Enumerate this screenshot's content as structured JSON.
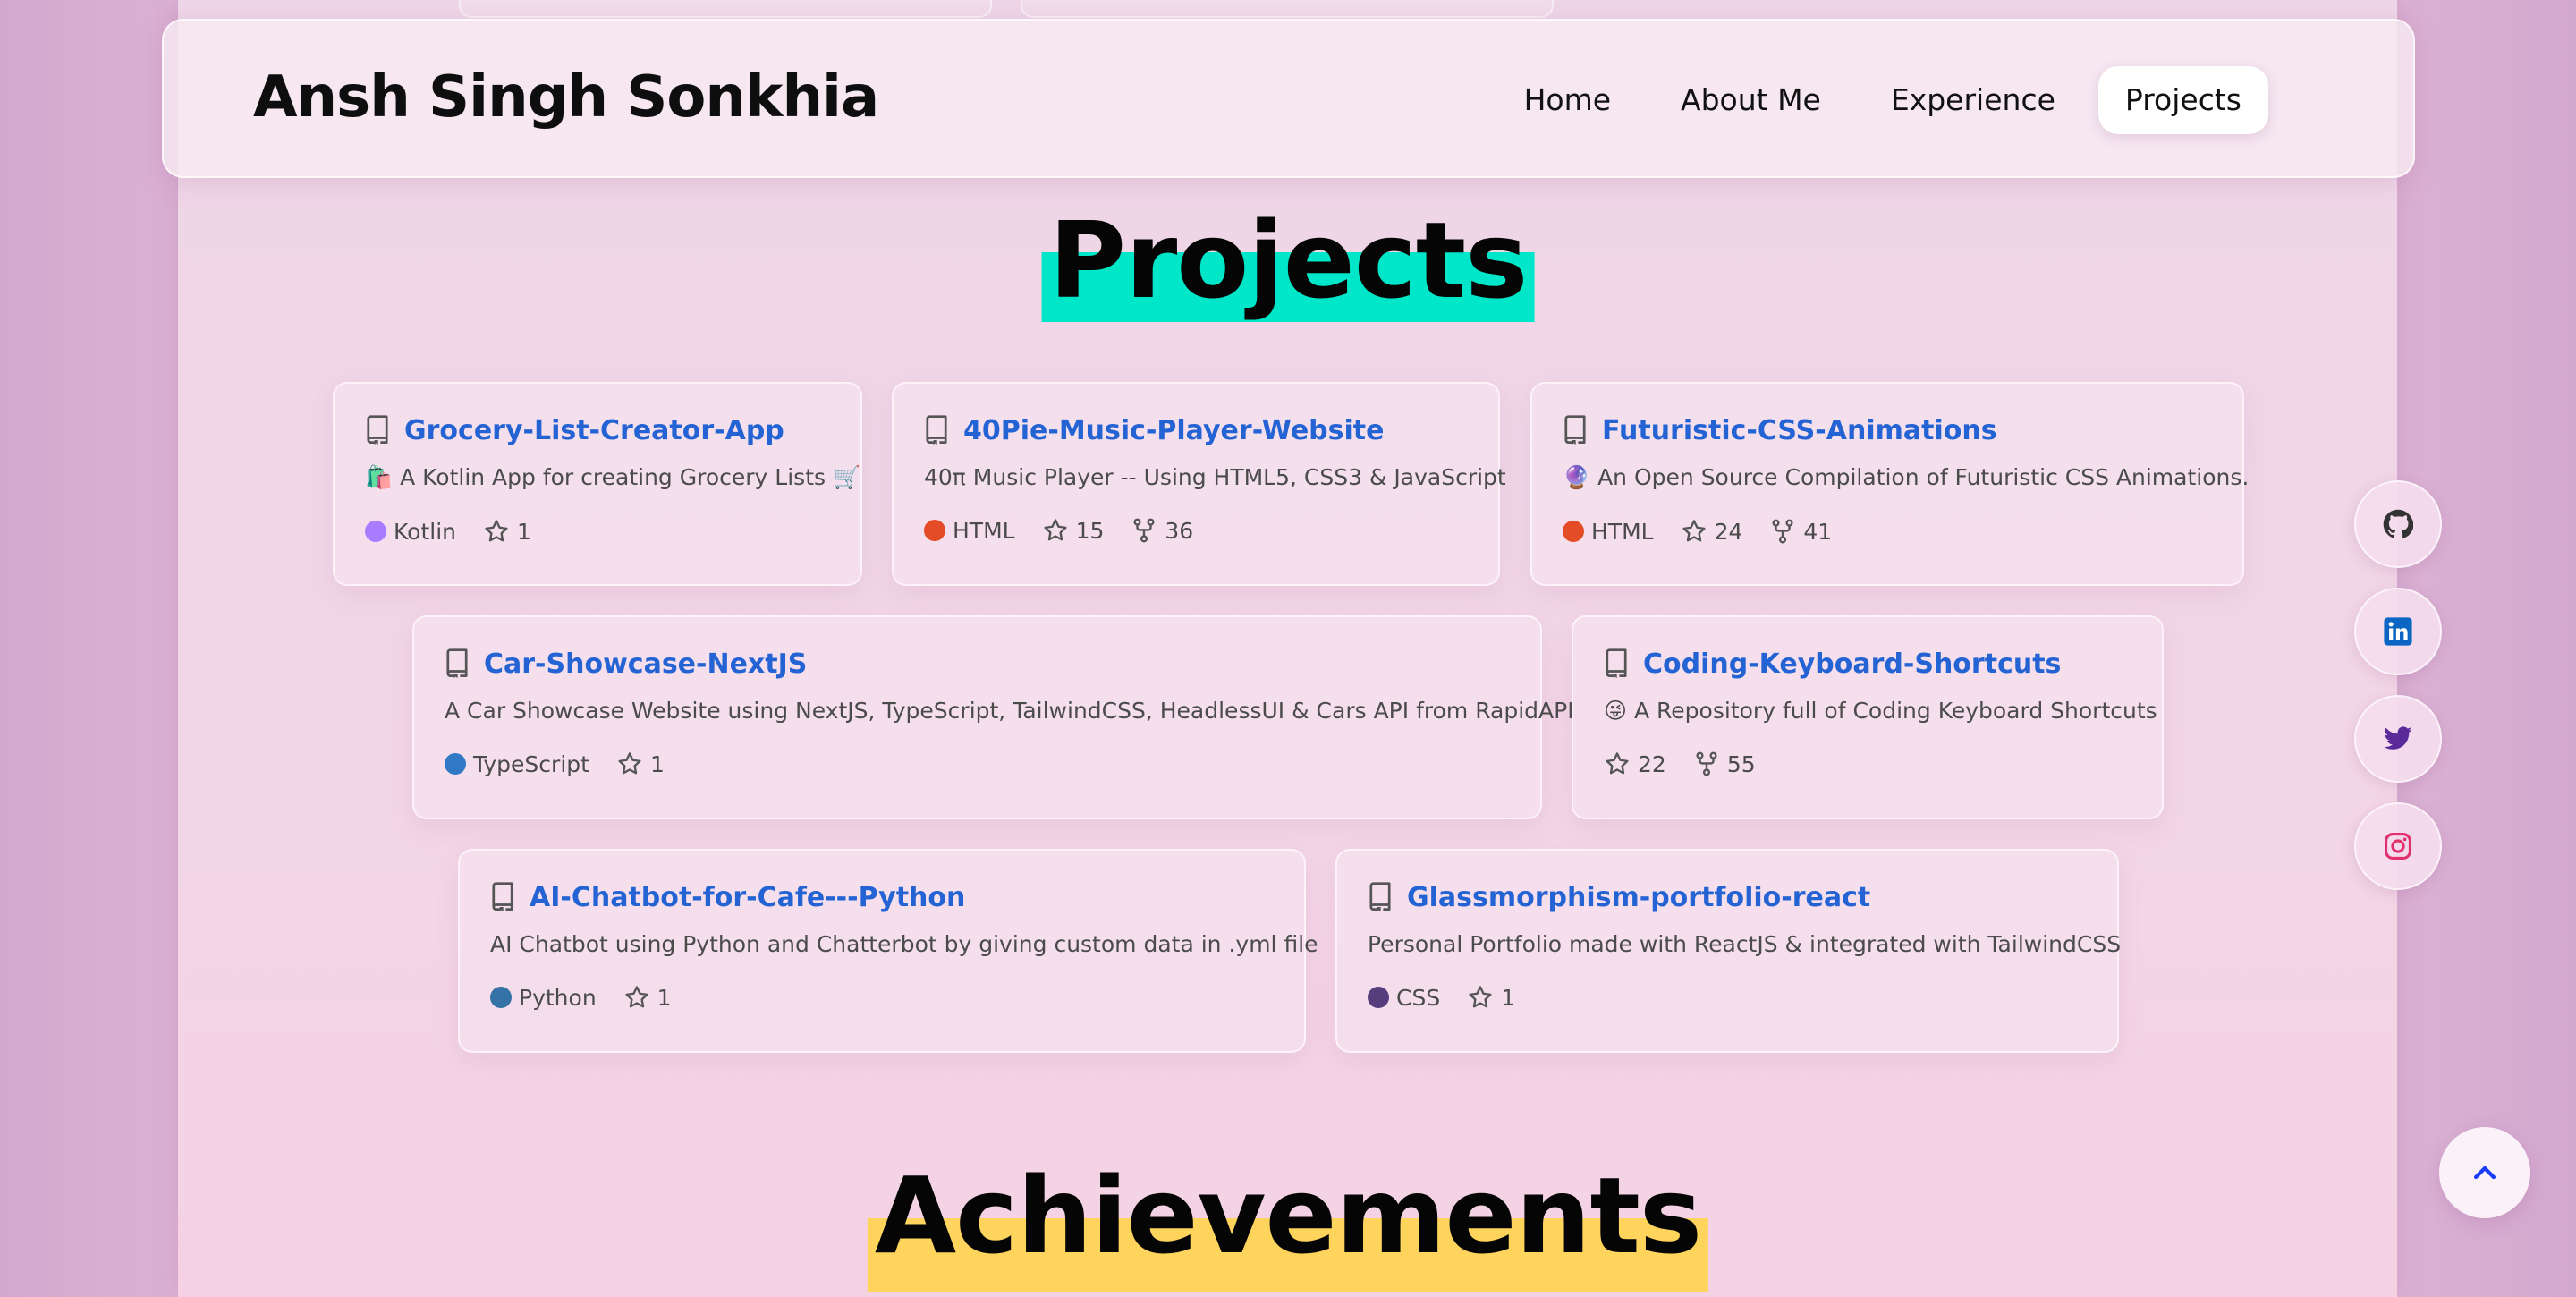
{
  "navbar": {
    "brand": "Ansh Singh Sonkhia",
    "links": [
      "Home",
      "About Me",
      "Experience",
      "Projects"
    ],
    "active": "Projects"
  },
  "projects_section": {
    "title": "Projects",
    "highlight_color": "#00e6c8",
    "cards": [
      {
        "name": "Grocery-List-Creator-App",
        "desc": "🛍️ A Kotlin App for creating Grocery Lists 🛒",
        "language": "Kotlin",
        "lang_color": "#a97bff",
        "stars": "1",
        "forks": null
      },
      {
        "name": "40Pie-Music-Player-Website",
        "desc": "40π Music Player -- Using HTML5, CSS3 & JavaScript",
        "language": "HTML",
        "lang_color": "#e34c26",
        "stars": "15",
        "forks": "36"
      },
      {
        "name": "Futuristic-CSS-Animations",
        "desc": "🔮 An Open Source Compilation of Futuristic CSS Animations.",
        "language": "HTML",
        "lang_color": "#e34c26",
        "stars": "24",
        "forks": "41"
      },
      {
        "name": "Car-Showcase-NextJS",
        "desc": "A Car Showcase Website using NextJS, TypeScript, TailwindCSS, HeadlessUI & Cars API from RapidAPI",
        "language": "TypeScript",
        "lang_color": "#3178c6",
        "stars": "1",
        "forks": null
      },
      {
        "name": "Coding-Keyboard-Shortcuts",
        "desc": "😜 A Repository full of Coding Keyboard Shortcuts",
        "language": null,
        "lang_color": null,
        "stars": "22",
        "forks": "55"
      },
      {
        "name": "AI-Chatbot-for-Cafe---Python",
        "desc": "AI Chatbot using Python and Chatterbot by giving custom data in .yml file",
        "language": "Python",
        "lang_color": "#3572a5",
        "stars": "1",
        "forks": null
      },
      {
        "name": "Glassmorphism-portfolio-react",
        "desc": "Personal Portfolio made with ReactJS & integrated with TailwindCSS",
        "language": "CSS",
        "lang_color": "#563d7c",
        "stars": "1",
        "forks": null
      }
    ]
  },
  "achievements_section": {
    "title": "Achievements",
    "highlight_color": "#ffd45c"
  },
  "socials": [
    {
      "name": "github",
      "icon": "github-icon",
      "color": "#333333"
    },
    {
      "name": "linkedin",
      "icon": "linkedin-icon",
      "color": "#0a66c2"
    },
    {
      "name": "twitter",
      "icon": "twitter-icon",
      "color": "#5b2a9a"
    },
    {
      "name": "instagram",
      "icon": "instagram-icon",
      "color": "#e1306c"
    }
  ],
  "back_to_top": {
    "icon": "chevron-up-icon",
    "color": "#1a3cff"
  }
}
